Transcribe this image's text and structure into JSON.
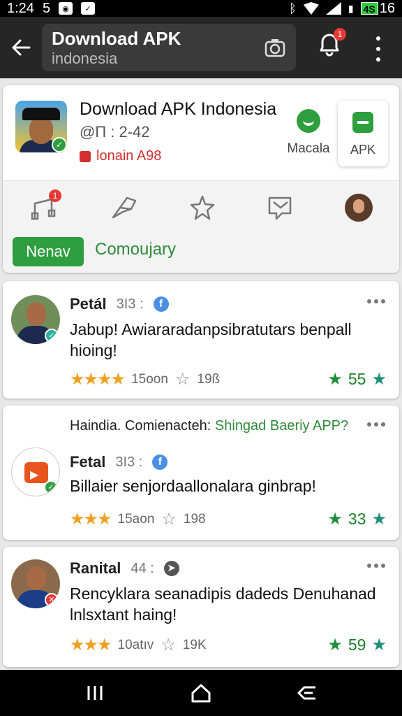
{
  "status_bar": {
    "time": "1:24",
    "notif_count": "5",
    "battery_label": "4S",
    "battery_num": "16"
  },
  "app_bar": {
    "title": "Download APK",
    "subtitle": "indonesia",
    "notif_badge": "1"
  },
  "header": {
    "name": "Download APK Indonesia",
    "handle": "@П : 2-42",
    "tag": "lonain A98",
    "action1_label": "Macala",
    "action2_label": "APK",
    "toolbar_badge": "1",
    "nav_button": "Nenav",
    "community_tab": "Comoujary"
  },
  "posts": [
    {
      "name": "Petál",
      "meta": "3I3 :",
      "badge_color": "#4a8fe3",
      "text": "Jabup! Awiararadanpsibratutars benpall hioing!",
      "stars": "★★★★",
      "half": "★",
      "count": "15oon",
      "saves": "19ß",
      "score": "55"
    },
    {
      "intro_prefix": "Haindia. Comienacteh:",
      "intro_link": "Shingad Baeriy APP?",
      "name": "Fetal",
      "meta": "3I3 :",
      "text": "Billaier senjordaallonalara ginbrap!",
      "stars": "★★★",
      "half": "★",
      "count": "15aon",
      "saves": "198",
      "score": "33"
    },
    {
      "name": "Ranital",
      "meta": "44 :",
      "text": "Rencyklara seanadipis dadeds Denuhanad lnlsxtant haing!",
      "stars": "★★★",
      "half": "★",
      "count": "10atıv",
      "saves": "19K",
      "score": "59"
    }
  ],
  "colors": {
    "accent_green": "#2e9e3e",
    "badge_red": "#e53935",
    "star_orange": "#f0a020"
  },
  "icons": [
    "back-arrow-icon",
    "camera-icon",
    "bell-icon",
    "more-vert-icon",
    "music-icon",
    "share-icon",
    "star-icon",
    "message-icon",
    "facebook-icon",
    "recent-apps-icon",
    "home-icon",
    "back-nav-icon"
  ]
}
